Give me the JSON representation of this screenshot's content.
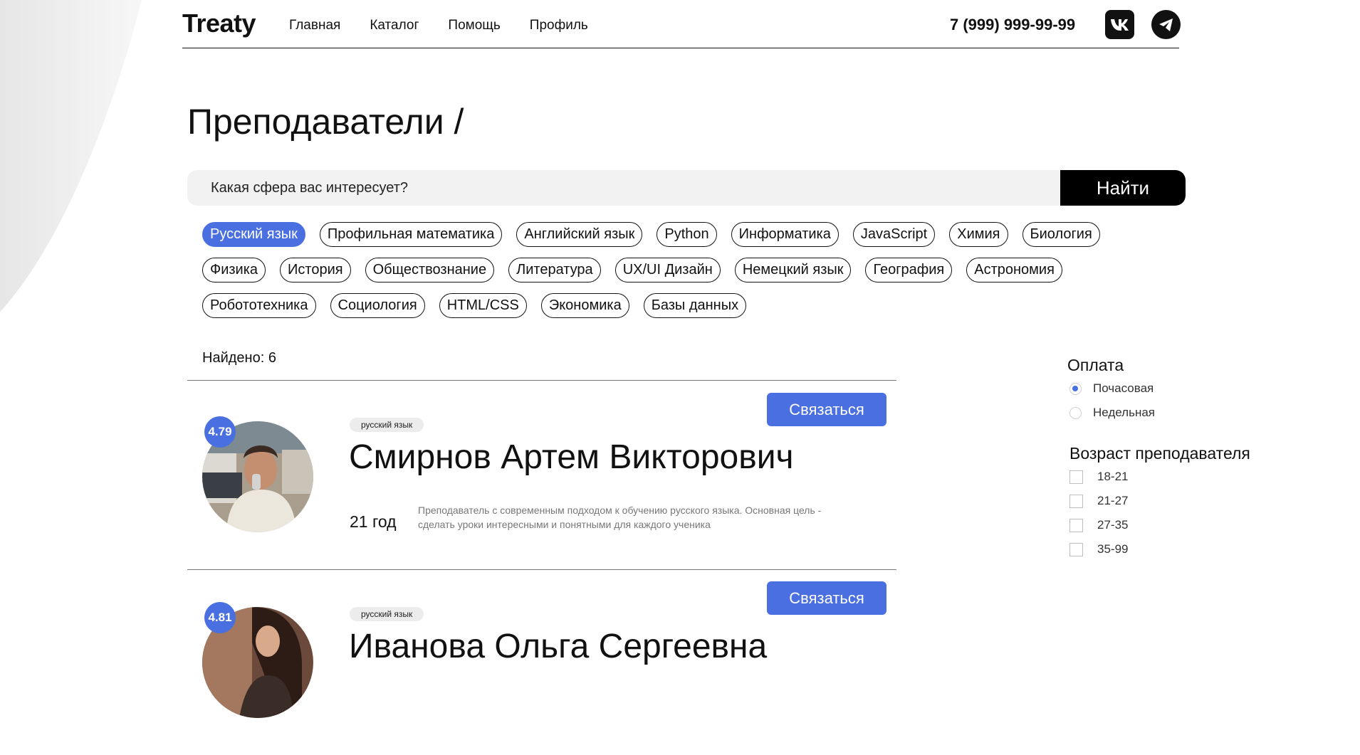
{
  "header": {
    "logo": "Treaty",
    "nav": [
      "Главная",
      "Каталог",
      "Помощь",
      "Профиль"
    ],
    "phone": "7 (999) 999-99-99",
    "social_icons": [
      "vk-icon",
      "telegram-icon"
    ]
  },
  "page": {
    "title": "Преподаватели /"
  },
  "search": {
    "placeholder": "Какая сфера вас интересует?",
    "button_label": "Найти"
  },
  "tags": {
    "rows": [
      [
        "Русский язык",
        "Профильная математика",
        "Английский язык",
        "Python",
        "Информатика",
        "JavaScript",
        "Химия",
        "Биология"
      ],
      [
        "Физика",
        "История",
        "Обществознание",
        "Литература",
        "UX/UI Дизайн",
        "Немецкий язык",
        "География",
        "Астрономия"
      ],
      [
        "Робототехника",
        "Социология",
        "HTML/CSS",
        "Экономика",
        "Базы данных"
      ]
    ],
    "active": "Русский язык"
  },
  "results": {
    "found_label": "Найдено: 6",
    "teachers": [
      {
        "rating": "4.79",
        "subject": "русский язык",
        "name": "Смирнов Артем Викторович",
        "age": "21 год",
        "description": "Преподаватель с современным подходом к обучению русского языка. Основная цель - сделать уроки интересными и понятными для каждого ученика",
        "contact_label": "Связаться"
      },
      {
        "rating": "4.81",
        "subject": "русский язык",
        "name": "Иванова Ольга Сергеевна",
        "contact_label": "Связаться"
      }
    ]
  },
  "filters": {
    "payment": {
      "title": "Оплата",
      "options": [
        "Почасовая",
        "Недельная"
      ],
      "selected": "Почасовая"
    },
    "age": {
      "title": "Возраст преподавателя",
      "options": [
        "18-21",
        "21-27",
        "27-35",
        "35-99"
      ]
    }
  },
  "colors": {
    "accent": "#4a6fe0",
    "dark": "#111111",
    "search_bg": "#f2f2f2"
  }
}
